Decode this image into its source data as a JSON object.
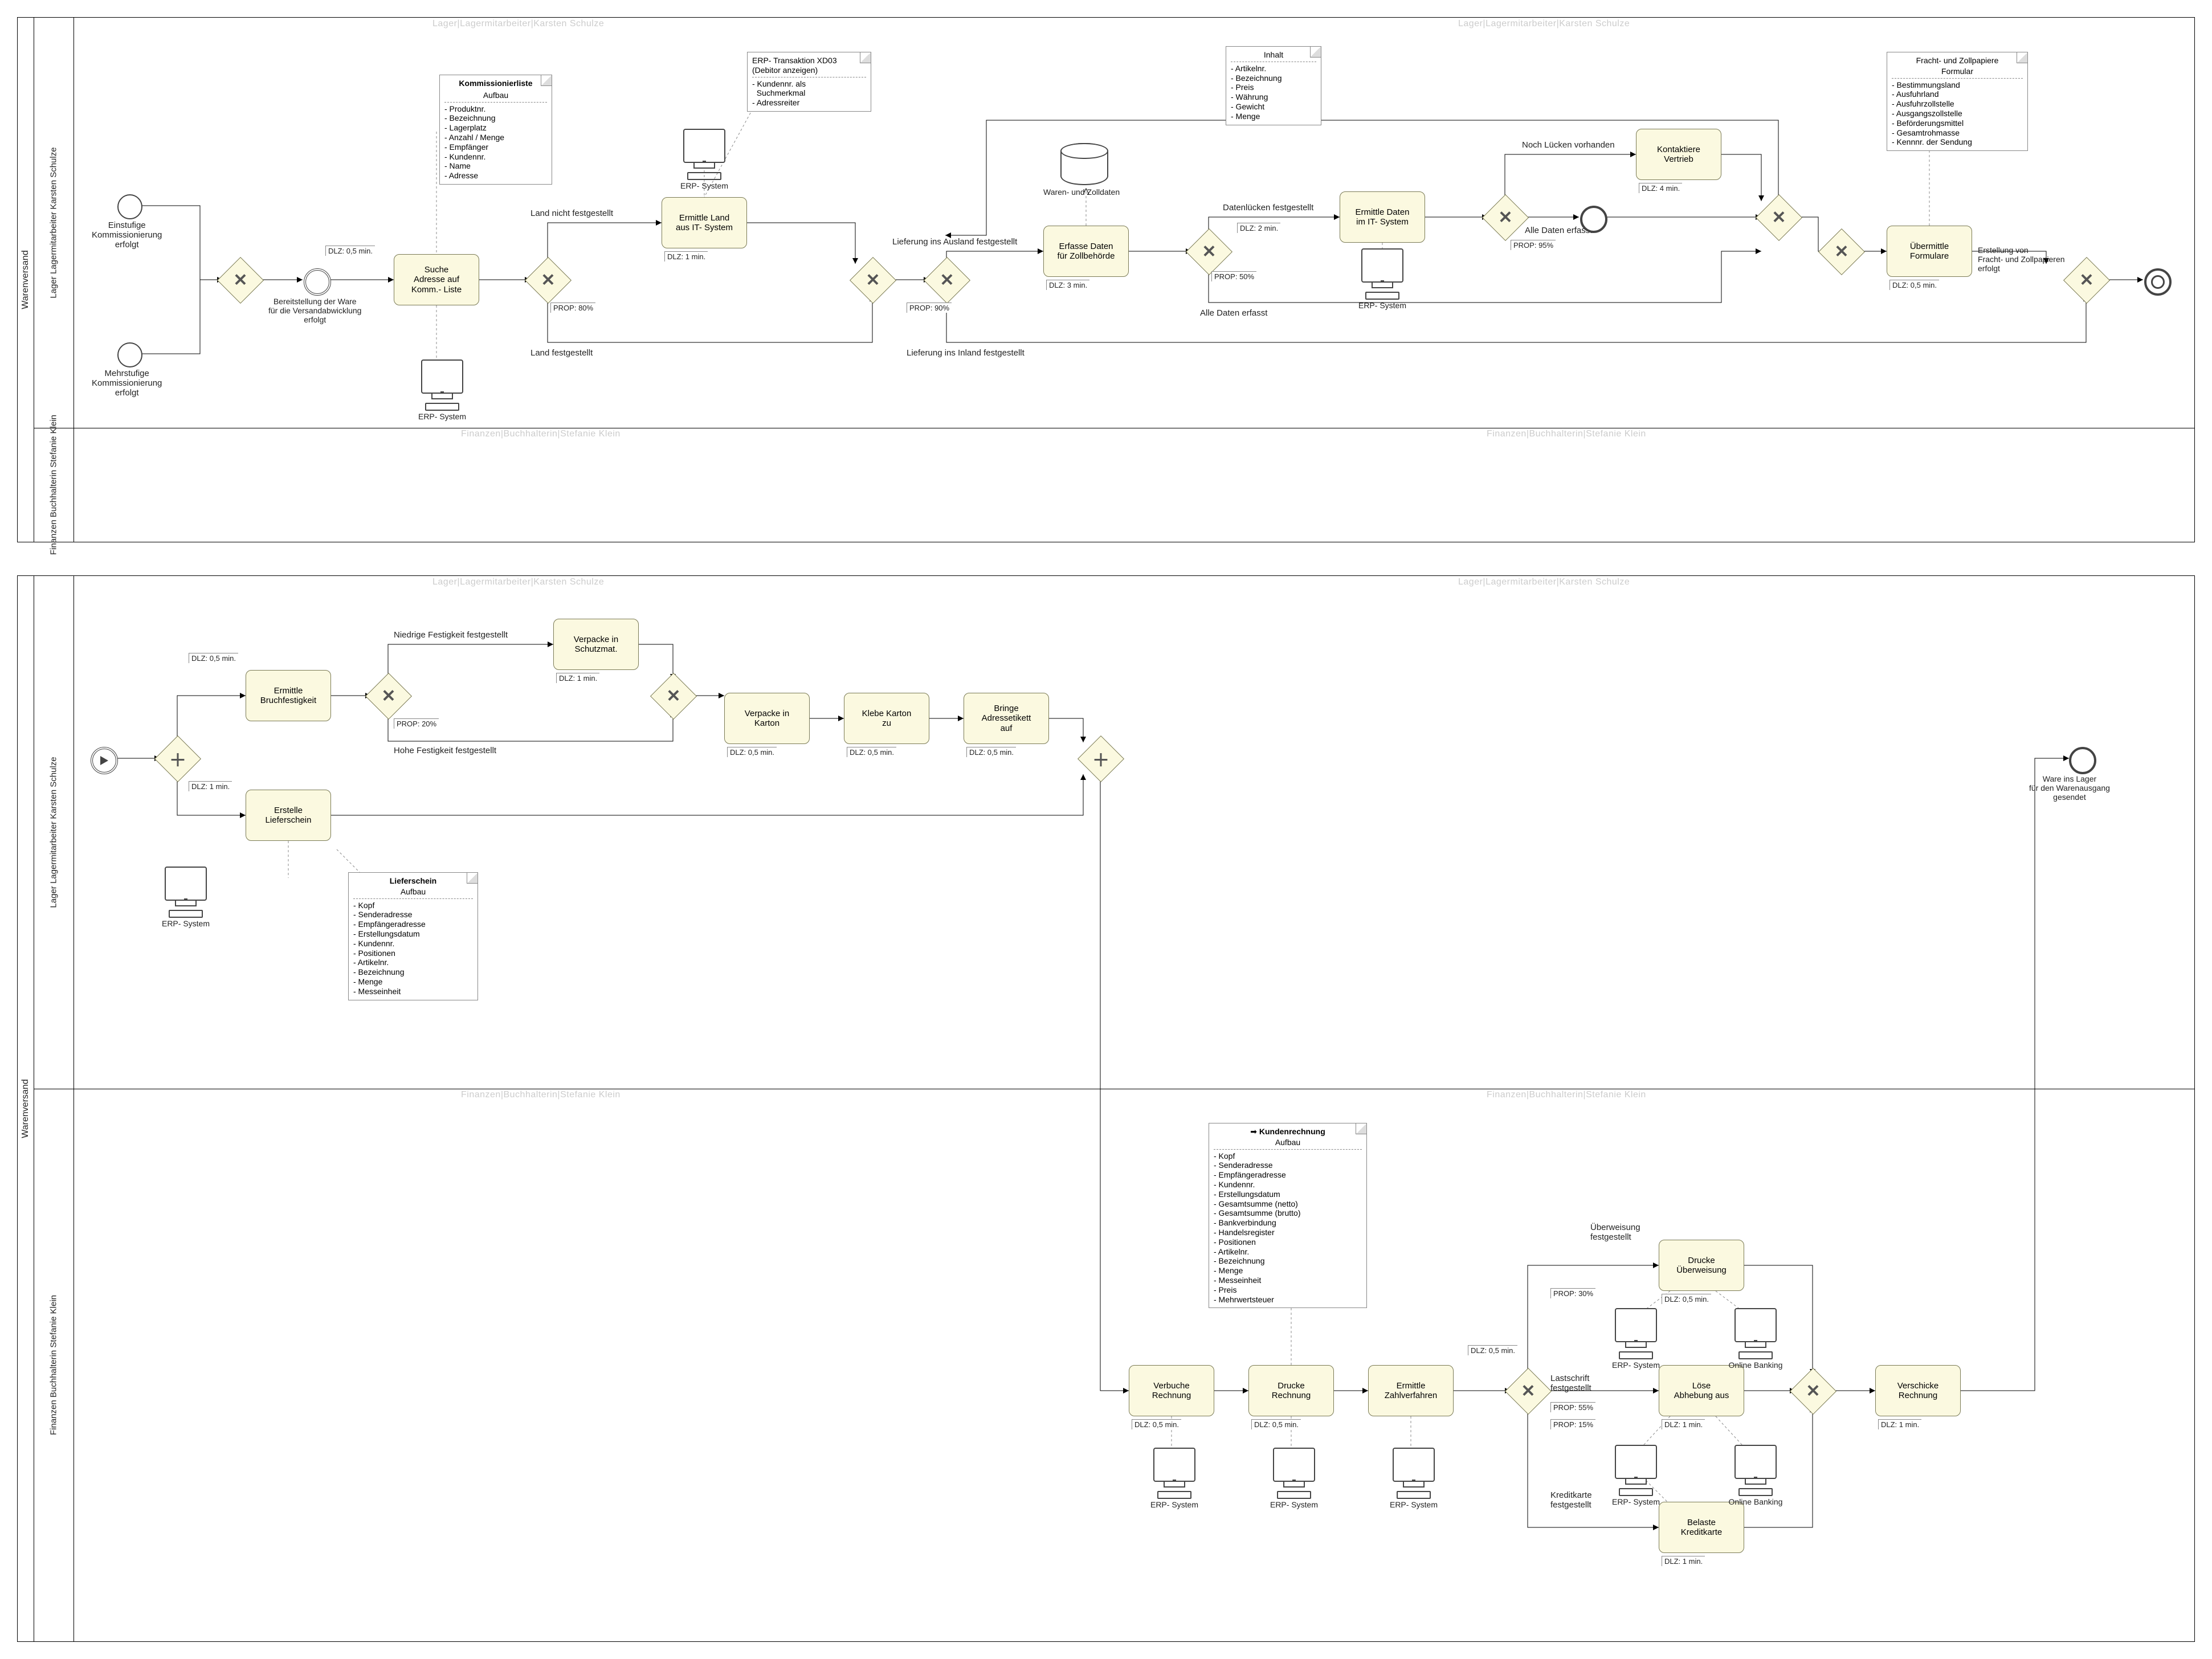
{
  "pool_label": "Warenversand",
  "watermarks": {
    "top_lane": "Lager|Lagermitarbeiter|Karsten Schulze",
    "bottom_lane": "Finanzen|Buchhalterin|Stefanie Klein"
  },
  "lanes": {
    "lager": "Lager\nLagermitarbeiter\nKarsten Schulze",
    "finanzen": "Finanzen\nBuchhalterin\nStefanie Klein"
  },
  "pool1": {
    "start_events": {
      "e1": "Einstufige\nKommissionierung\nerfolgt",
      "e2": "Mehrstufige\nKommissionierung\nerfolgt"
    },
    "inter_ev_label": "Bereitstellung der Ware\nfür die Versandabwicklung\nerfolgt",
    "tasks": {
      "t1": "Suche\nAdresse auf\nKomm.- Liste",
      "t2": "Ermittle Land\naus IT- System",
      "t3": "Erfasse Daten\nfür Zollbehörde",
      "t4": "Ermittle Daten\nim IT- System",
      "t5": "Kontaktiere\nVertrieb",
      "t6": "Übermittle\nFormulare"
    },
    "dlz": {
      "t1": "DLZ: 0,5 min.",
      "t2": "DLZ: 1 min.",
      "t3": "DLZ: 3 min.",
      "t4": "DLZ: 2 min.",
      "t5": "DLZ: 4 min.",
      "t6": "DLZ: 0,5 min."
    },
    "prop": {
      "p_t2": "PROP: 80%",
      "p_t3": "PROP: 90%",
      "p_t4": "PROP: 50%",
      "p_all": "PROP: 95%"
    },
    "edge_labels": {
      "land_nicht": "Land nicht festgestellt",
      "land_fest": "Land festgestellt",
      "ausland": "Lieferung ins Ausland festgestellt",
      "inland": "Lieferung ins Inland festgestellt",
      "datenluecken": "Datenlücken festgestellt",
      "alle_erfasst1": "Alle Daten erfasst",
      "alle_erfasst2": "Alle Daten erfasst",
      "luecken": "Noch Lücken vorhanden"
    },
    "end_label": "Erstellung von\nFracht- und Zollpapieren\nerfolgt",
    "notes": {
      "kommliste_title": "Kommissionierliste",
      "kommliste_sub": "Aufbau",
      "kommliste_items": [
        "Produktnr.",
        "Bezeichnung",
        "Lagerplatz",
        "Anzahl / Menge",
        "Empfänger",
        "Kundennr.",
        "Name",
        "Adresse"
      ],
      "erp_trx_title": "ERP- Transaktion XD03\n(Debitor anzeigen)",
      "erp_trx_items": [
        "Kundennr. als\nSuchmerkmal",
        "Adressreiter"
      ],
      "zolldaten_title": "Inhalt",
      "zolldaten_items": [
        "Artikelnr.",
        "Bezeichnung",
        "Preis",
        "Währung",
        "Gewicht",
        "Menge"
      ],
      "fracht_title": "Fracht- und Zollpapiere",
      "fracht_sub": "Formular",
      "fracht_items": [
        "Bestimmungsland",
        "Ausfuhrland",
        "Ausfuhrzollstelle",
        "Ausgangszollstelle",
        "Beförderungsmittel",
        "Gesamtrohmasse",
        "Kennnr. der Sendung"
      ]
    },
    "sys_labels": {
      "erp": "ERP- System",
      "warenzoll": "Waren- und Zolldaten"
    }
  },
  "pool2": {
    "lane1": {
      "tasks": {
        "t_bruch": "Ermittle\nBruchfestigkeit",
        "t_liefer": "Erstelle\nLieferschein",
        "t_schutz": "Verpacke in\nSchutzmat.",
        "t_karton": "Verpacke in\nKarton",
        "t_klebe": "Klebe Karton\nzu",
        "t_etikett": "Bringe\nAdressetikett\nauf"
      },
      "dlz": {
        "bruch": "DLZ: 0,5 min.",
        "liefer": "DLZ: 1 min.",
        "schutz": "DLZ: 1 min.",
        "karton": "DLZ: 0,5 min.",
        "klebe": "DLZ: 0,5 min.",
        "etikett": "DLZ: 0,5 min."
      },
      "prop_schutz": "PROP: 20%",
      "edges": {
        "niedrig": "Niedrige Festigkeit festgestellt",
        "hoch": "Hohe Festigkeit festgestellt"
      },
      "end_label": "Ware ins Lager\nfür den Warenausgang\ngesendet",
      "note_liefer_title": "Lieferschein",
      "note_liefer_sub": "Aufbau",
      "note_liefer_items": [
        "Kopf",
        "Senderadresse",
        "Empfängeradresse",
        "Erstellungsdatum",
        "Kundennr.",
        "Positionen",
        "Artikelnr.",
        "Bezeichnung",
        "Menge",
        "Messeinheit"
      ]
    },
    "lane2": {
      "tasks": {
        "verbuche": "Verbuche\nRechnung",
        "drucke_r": "Drucke\nRechnung",
        "ermit_zv": "Ermittle\nZahlverfahren",
        "drucke_u": "Drucke\nÜberweisung",
        "loese": "Löse\nAbhebung aus",
        "belaste": "Belaste\nKreditkarte",
        "verschicke": "Verschicke\nRechnung"
      },
      "dlz": {
        "verbuche": "DLZ: 0,5 min.",
        "drucke_r": "DLZ: 0,5 min.",
        "ermit_zv": "DLZ: 0,5 min.",
        "drucke_u": "DLZ: 0,5 min.",
        "loese": "DLZ: 1 min.",
        "belaste": "DLZ: 1 min.",
        "verschicke": "DLZ: 1 min."
      },
      "prop": {
        "ueber": "PROP: 30%",
        "last": "PROP: 55%",
        "kk": "PROP: 15%"
      },
      "edges": {
        "ueber": "Überweisung\nfestgestellt",
        "last": "Lastschrift\nfestgestellt",
        "kk": "Kreditkarte\nfestgestellt"
      },
      "note_rech_title": "Kundenrechnung",
      "note_rech_sub": "Aufbau",
      "note_rech_items": [
        "Kopf",
        "Senderadresse",
        "Empfängeradresse",
        "Kundennr.",
        "Erstellungsdatum",
        "Gesamtsumme (netto)",
        "Gesamtsumme (brutto)",
        "Bankverbindung",
        "Handelsregister",
        "Positionen",
        "Artikelnr.",
        "Bezeichnung",
        "Menge",
        "Messeinheit",
        "Preis",
        "Mehrwertsteuer"
      ],
      "sys": {
        "erp": "ERP- System",
        "online": "Online Banking"
      }
    }
  }
}
